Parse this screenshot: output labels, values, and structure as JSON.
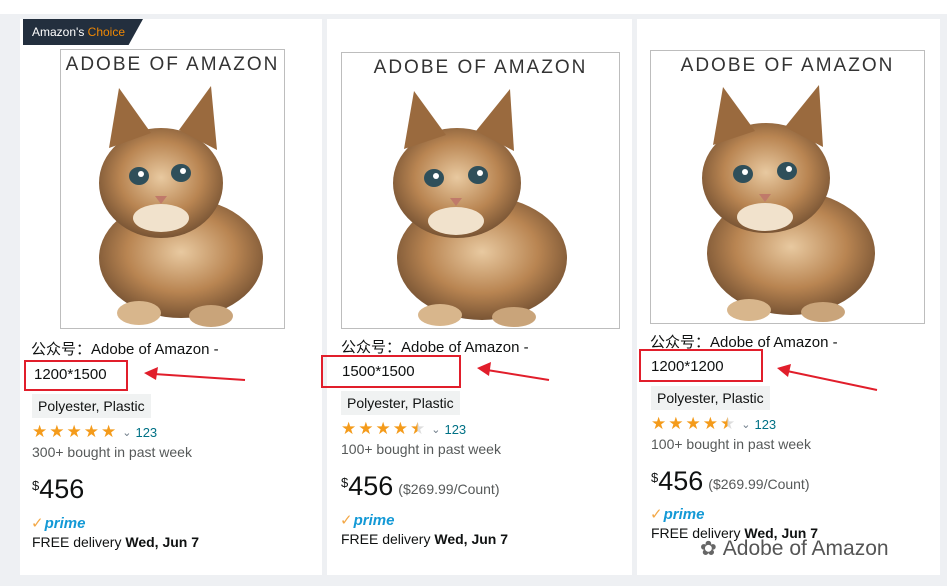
{
  "badge": {
    "part1": "Amazon's",
    "part2": "Choice"
  },
  "top_fragment": "...",
  "frame_title": "ADOBE OF AMAZON",
  "products": [
    {
      "title": "公众号：Adobe of Amazon -",
      "size": "1200*1500",
      "material": "Polyester, Plastic",
      "rating": 5,
      "rating_count": "123",
      "bought": "300+ bought in past week",
      "price_symbol": "$",
      "price": "456",
      "unit_price": "",
      "prime": "prime",
      "delivery_label": "FREE delivery",
      "delivery_date": "Wed, Jun 7"
    },
    {
      "title": "公众号：Adobe of Amazon -",
      "size": "1500*1500",
      "material": "Polyester, Plastic",
      "rating": 4.5,
      "rating_count": "123",
      "bought": "100+ bought in past week",
      "price_symbol": "$",
      "price": "456",
      "unit_price": "($269.99/Count)",
      "prime": "prime",
      "delivery_label": "FREE delivery",
      "delivery_date": "Wed, Jun 7"
    },
    {
      "title": "公众号：Adobe of Amazon -",
      "size": "1200*1200",
      "material": "Polyester, Plastic",
      "rating": 4.5,
      "rating_count": "123",
      "bought": "100+ bought in past week",
      "price_symbol": "$",
      "price": "456",
      "unit_price": "($269.99/Count)",
      "prime": "prime",
      "delivery_label": "FREE delivery",
      "delivery_date": "Wed, Jun 7"
    }
  ],
  "watermark": "Adobe of Amazon",
  "colors": {
    "highlight": "#e11e2b",
    "star": "#f49b1b",
    "prime": "#1399d6",
    "link": "#007185",
    "badge_bg": "#232f3e",
    "badge_accent": "#f08804"
  }
}
